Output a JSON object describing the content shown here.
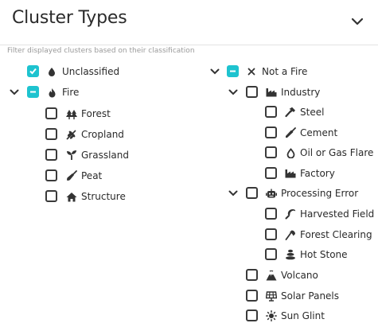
{
  "header": {
    "title": "Cluster Types",
    "hint": "Filter displayed clusters based on their classification"
  },
  "left": {
    "unclassified": "Unclassified",
    "fire": "Fire",
    "forest": "Forest",
    "cropland": "Cropland",
    "grassland": "Grassland",
    "peat": "Peat",
    "structure": "Structure"
  },
  "right": {
    "not_a_fire": "Not a Fire",
    "industry": "Industry",
    "steel": "Steel",
    "cement": "Cement",
    "oil_gas": "Oil or Gas Flare",
    "factory": "Factory",
    "processing_error": "Processing Error",
    "harvested": "Harvested Field",
    "forest_clearing": "Forest Clearing",
    "hot_stone": "Hot Stone",
    "volcano": "Volcano",
    "solar": "Solar Panels",
    "sun_glint": "Sun Glint"
  },
  "colors": {
    "accent": "#1ec3cf",
    "border": "#3a3a3a"
  }
}
